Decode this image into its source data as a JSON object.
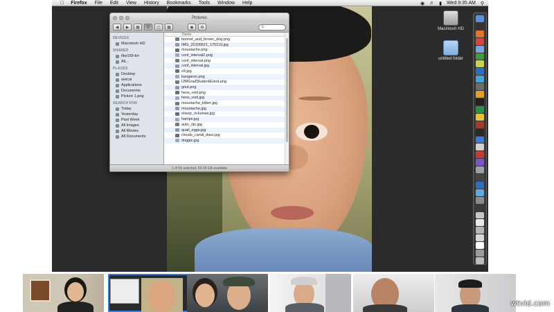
{
  "menubar": {
    "apple_icon": "apple-icon",
    "app_name": "Firefox",
    "items": [
      "File",
      "Edit",
      "View",
      "History",
      "Bookmarks",
      "Tools",
      "Window",
      "Help"
    ],
    "clock": "Wed 9:35 AM"
  },
  "desktop_icons": [
    {
      "label": "Macintosh HD",
      "icon": "hard-drive-icon"
    },
    {
      "label": "untitled folder",
      "icon": "folder-icon"
    }
  ],
  "finder": {
    "title": "Pictures",
    "search_placeholder": "",
    "sidebar": {
      "devices": {
        "heading": "DEVICES",
        "items": [
          "Macintosh HD"
        ]
      },
      "shared": {
        "heading": "SHARED",
        "items": [
          "fike169-bri",
          "All..."
        ]
      },
      "places": {
        "heading": "PLACES",
        "items": [
          "Desktop",
          "weicai",
          "Applications",
          "Documents",
          "Picture 1.png"
        ]
      },
      "search_for": {
        "heading": "SEARCH FOR",
        "items": [
          "Today",
          "Yesterday",
          "Past Week",
          "All Images",
          "All Movies",
          "All Documents"
        ]
      }
    },
    "column_header": "Name",
    "files": [
      "bonnet_and_brown_dog.png",
      "IMG_20100621_175119.jpg",
      "moustache.png",
      "conf_interval2.png",
      "conf_interval.png",
      "conf_interval.jpg",
      "s9.jpg",
      "kangaroo.png",
      "UWGradStudentEvent.png",
      "gout.png",
      "hess_visit.png",
      "hess_visit.jpg",
      "moustache_kitten.jpg",
      "moustache.jpg",
      "sheep_rickshaw.jpg",
      "hamps.jpg",
      "auto_rijo.jpg",
      "quail_eggs.jpg",
      "clouds_candi_dass.jpg",
      "doggie.jpg"
    ],
    "status": "1 of 56 selected, 83.34 GB available"
  },
  "watermark": "wtvid.com"
}
